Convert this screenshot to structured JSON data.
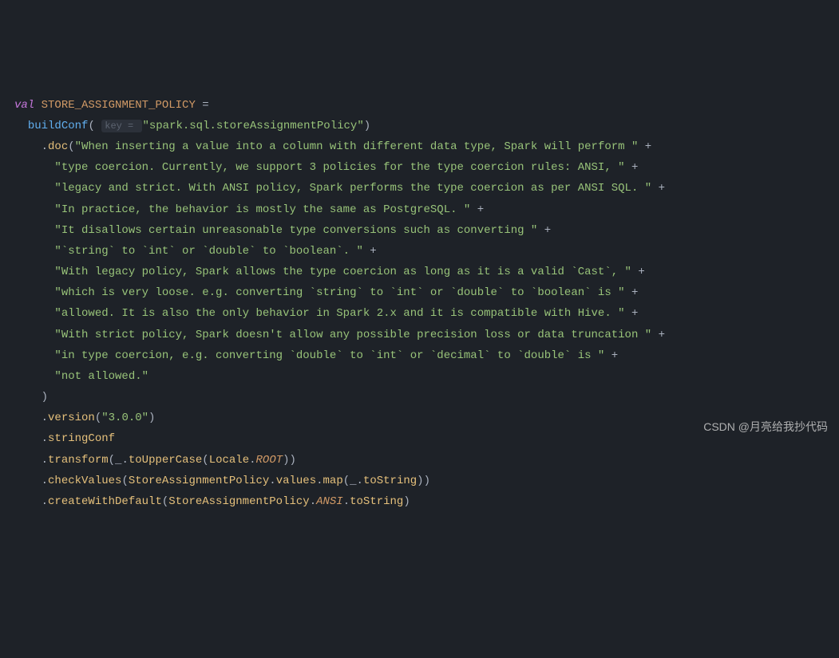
{
  "code": {
    "val": "val",
    "constName": "STORE_ASSIGNMENT_POLICY",
    "eq": " =",
    "buildConf": "buildConf",
    "keyHint": "key = ",
    "keyString": "\"spark.sql.storeAssignmentPolicy\"",
    "doc": "doc",
    "docLines": [
      "\"When inserting a value into a column with different data type, Spark will perform \"",
      "\"type coercion. Currently, we support 3 policies for the type coercion rules: ANSI, \"",
      "\"legacy and strict. With ANSI policy, Spark performs the type coercion as per ANSI SQL. \"",
      "\"In practice, the behavior is mostly the same as PostgreSQL. \"",
      "\"It disallows certain unreasonable type conversions such as converting \"",
      "\"`string` to `int` or `double` to `boolean`. \"",
      "\"With legacy policy, Spark allows the type coercion as long as it is a valid `Cast`, \"",
      "\"which is very loose. e.g. converting `string` to `int` or `double` to `boolean` is \"",
      "\"allowed. It is also the only behavior in Spark 2.x and it is compatible with Hive. \"",
      "\"With strict policy, Spark doesn't allow any possible precision loss or data truncation \"",
      "\"in type coercion, e.g. converting `double` to `int` or `decimal` to `double` is \"",
      "\"not allowed.\""
    ],
    "version": "version",
    "versionString": "\"3.0.0\"",
    "stringConf": "stringConf",
    "transform": "transform",
    "toUpperCase": "toUpperCase",
    "Locale": "Locale",
    "ROOT": "ROOT",
    "checkValues": "checkValues",
    "StoreAssignmentPolicy": "StoreAssignmentPolicy",
    "values": "values",
    "map": "map",
    "toString": "toString",
    "createWithDefault": "createWithDefault",
    "ANSI": "ANSI"
  },
  "watermark": "CSDN @月亮给我抄代码"
}
